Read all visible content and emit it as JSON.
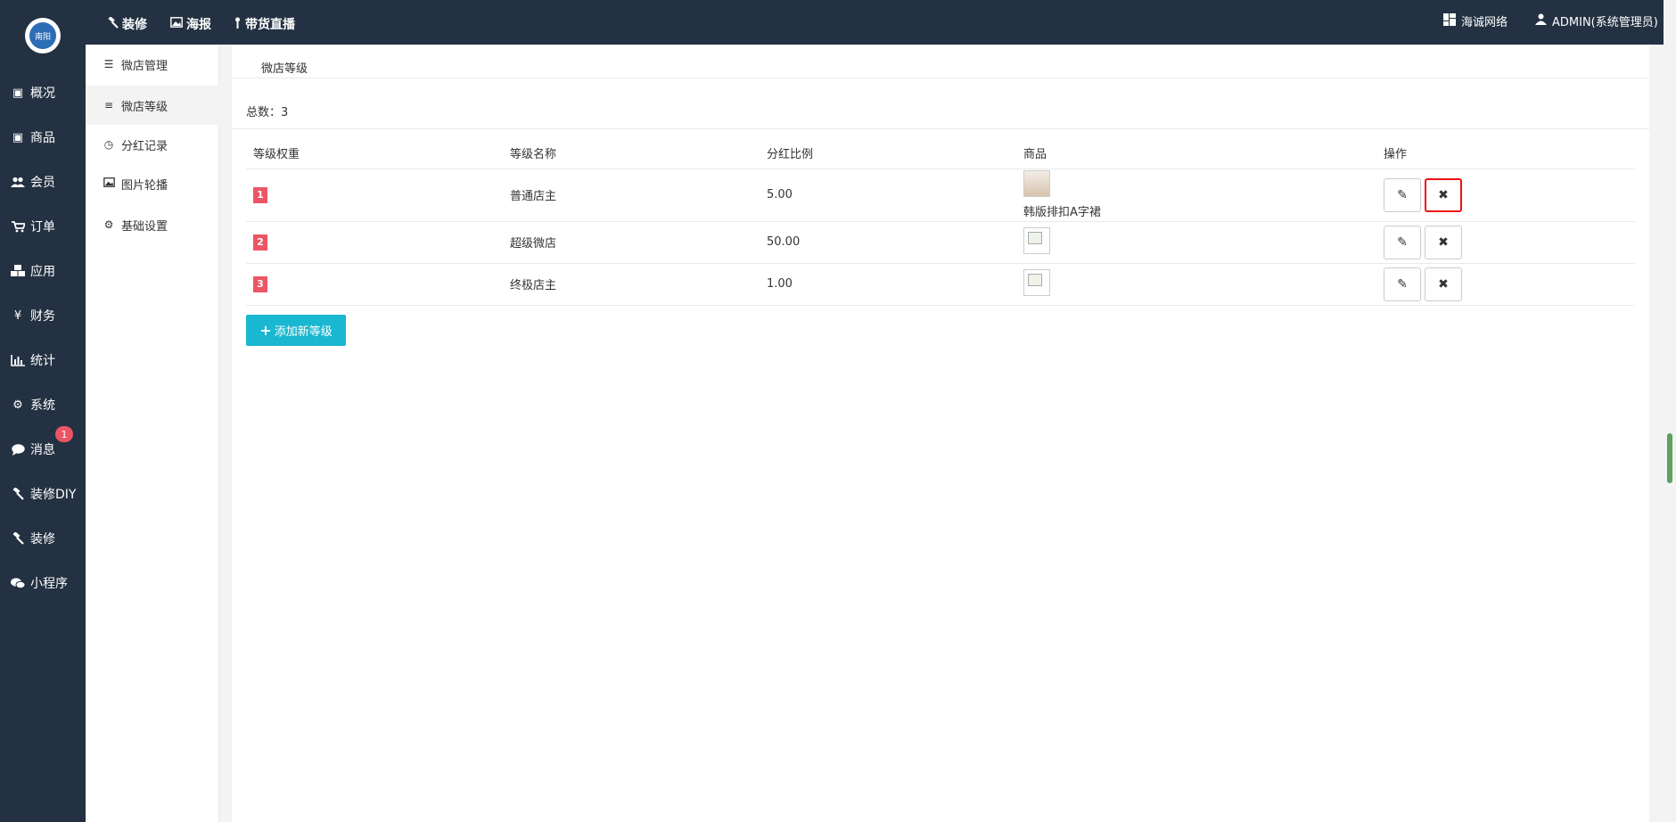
{
  "logo": {
    "text": "南阳"
  },
  "sidebar": {
    "items": [
      {
        "label": "概况",
        "icon": "dashboard-icon"
      },
      {
        "label": "商品",
        "icon": "goods-icon"
      },
      {
        "label": "会员",
        "icon": "users-icon"
      },
      {
        "label": "订单",
        "icon": "cart-icon"
      },
      {
        "label": "应用",
        "icon": "apps-icon"
      },
      {
        "label": "财务",
        "icon": "yen-icon"
      },
      {
        "label": "统计",
        "icon": "bar-chart-icon"
      },
      {
        "label": "系统",
        "icon": "gears-icon"
      },
      {
        "label": "消息",
        "icon": "comment-icon",
        "badge": "1"
      },
      {
        "label": "装修DIY",
        "icon": "gavel-icon"
      },
      {
        "label": "装修",
        "icon": "gavel-icon"
      },
      {
        "label": "小程序",
        "icon": "wechat-icon"
      }
    ]
  },
  "topbar": {
    "links": [
      {
        "label": "装修",
        "icon": "gavel-icon"
      },
      {
        "label": "海报",
        "icon": "image-icon"
      },
      {
        "label": "带货直播",
        "icon": "live-icon"
      }
    ],
    "company": "海诚网络",
    "user": "ADMIN(系统管理员)"
  },
  "subnav": {
    "items": [
      {
        "label": "微店管理",
        "icon": "list-icon"
      },
      {
        "label": "微店等级",
        "icon": "align-left-icon",
        "active": true
      },
      {
        "label": "分红记录",
        "icon": "clock-icon"
      },
      {
        "label": "图片轮播",
        "icon": "image-icon"
      },
      {
        "label": "基础设置",
        "icon": "gears-icon"
      }
    ]
  },
  "panel": {
    "tab": "微店等级",
    "total": "总数：3",
    "add_button": "添加新等级"
  },
  "table": {
    "headers": [
      "等级权重",
      "等级名称",
      "分红比例",
      "商品",
      "操作"
    ],
    "rows": [
      {
        "weight": "1",
        "name": "普通店主",
        "ratio": "5.00",
        "product": "韩版排扣A字裙",
        "has_image": true
      },
      {
        "weight": "2",
        "name": "超级微店",
        "ratio": "50.00",
        "product": "",
        "has_image": false
      },
      {
        "weight": "3",
        "name": "终极店主",
        "ratio": "1.00",
        "product": "",
        "has_image": false
      }
    ]
  },
  "colors": {
    "sidebar_bg": "#233142",
    "badge_red": "#ed5565",
    "add_button": "#1ab7d0",
    "highlight_border": "#e11111"
  }
}
